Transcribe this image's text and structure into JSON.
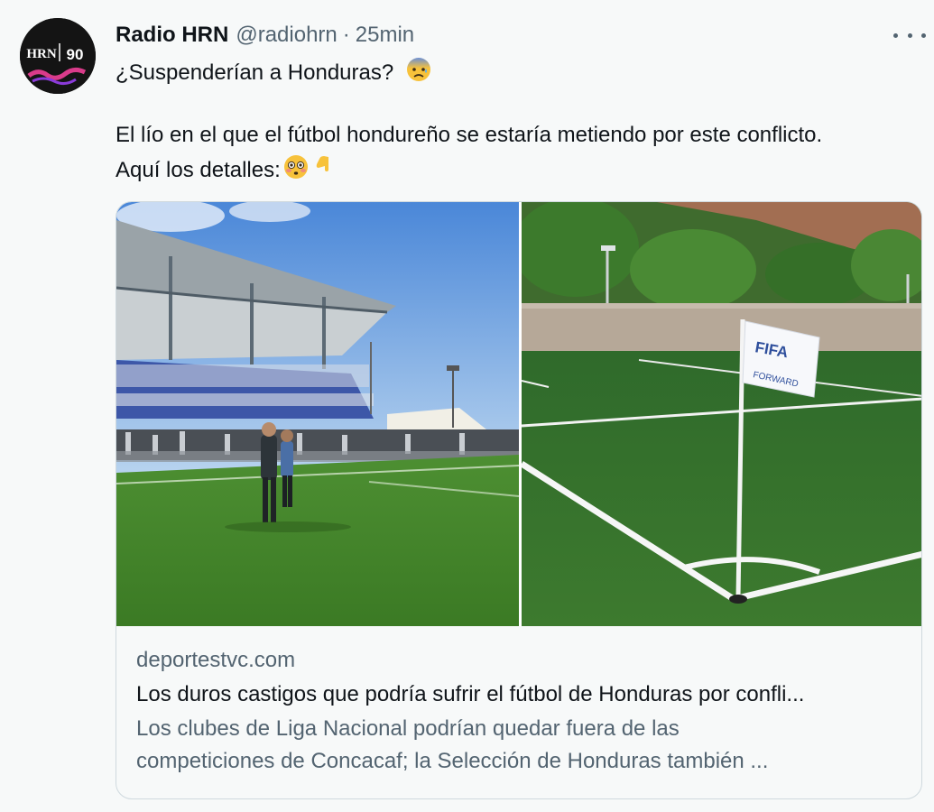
{
  "tweet": {
    "author_name": "Radio HRN",
    "handle": "@radiohrn",
    "separator": "·",
    "time": "25min",
    "avatar_text_left": "HRN",
    "avatar_text_right": "90",
    "line1": "¿Suspenderían a Honduras?",
    "line2": "El lío en el que el fútbol hondureño se estaría metiendo por este conflicto.",
    "line3": "Aquí los detalles:",
    "emoji1": "anxious-face-emoji",
    "emoji2": "flushed-face-emoji",
    "emoji3": "pointing-down-emoji"
  },
  "link_card": {
    "domain": "deportestvc.com",
    "title": "Los duros castigos que podría sufrir el fútbol de Honduras por confli...",
    "description_line1": "Los clubes de Liga Nacional podrían quedar fuera de las",
    "description_line2": "competiciones de Concacaf; la Selección de Honduras también ...",
    "flag_text": "FIFA",
    "flag_subtext": "FORWARD"
  },
  "colors": {
    "background": "#f7f9f9",
    "text_primary": "#0f1419",
    "text_secondary": "#536471",
    "border": "#cfd9de"
  }
}
